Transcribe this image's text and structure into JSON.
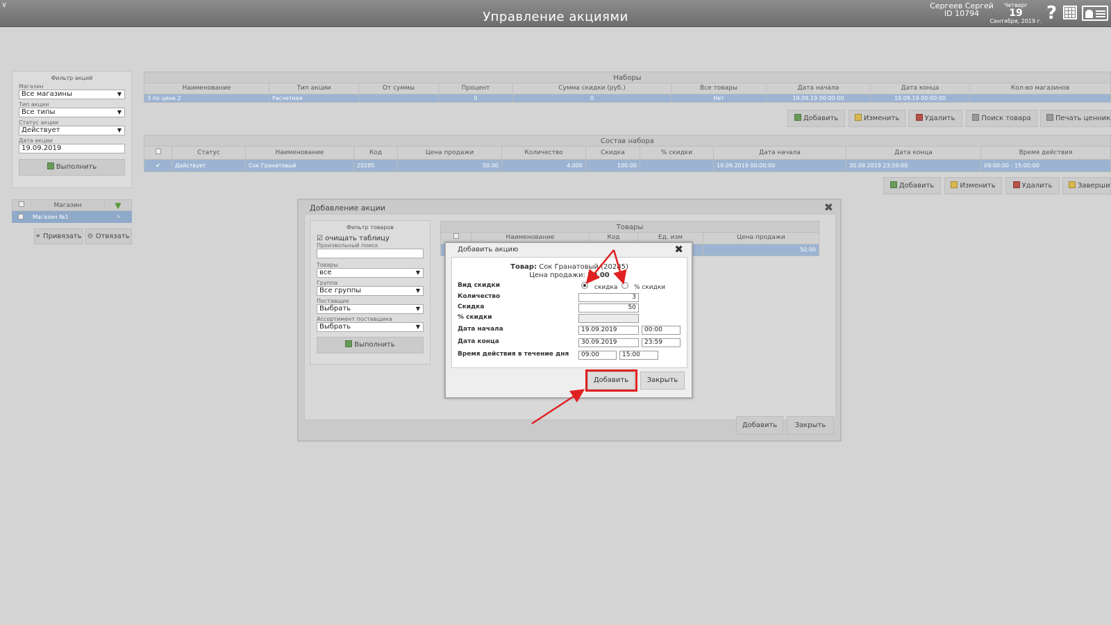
{
  "header": {
    "title": "Управление акциями",
    "user_name": "Сергеев Сергей",
    "user_id": "ID 10794",
    "weekday": "Четверг",
    "day": "19",
    "month_year": "Сентября, 2019 г.",
    "help_icon": "?",
    "icons": [
      "menu-grid-icon",
      "id-card-icon",
      "collapse-chevron-icon"
    ]
  },
  "filter": {
    "title": "Фильтр акций",
    "store_label": "Магазин",
    "store_value": "Все магазины",
    "type_label": "Тип акции",
    "type_value": "Все типы",
    "status_label": "Статус акции",
    "status_value": "Действует",
    "date_label": "Дата акции",
    "date_value": "19.09.2019",
    "run_label": "Выполнить"
  },
  "stores": {
    "header": "Магазин",
    "filter_icon": "funnel-icon",
    "rows": [
      {
        "name": "Магазин №1"
      }
    ],
    "bind_label": "Привязать",
    "unbind_label": "Отвязать"
  },
  "sets": {
    "title": "Наборы",
    "columns": [
      "Наименование",
      "Тип акции",
      "От суммы",
      "Процент",
      "Сумма скидки (руб.)",
      "Все товары",
      "Дата начала",
      "Дата конца",
      "Кол-во магазинов"
    ],
    "rows": [
      [
        "3 по цене 2",
        "Расчетная",
        "",
        "0",
        "0",
        "Нет",
        "19.09.19 00:00:00",
        "19.09.19 00:00:00",
        ""
      ]
    ],
    "buttons": [
      "Добавить",
      "Изменить",
      "Удалить",
      "Поиск товара",
      "Печать ценник"
    ]
  },
  "composition": {
    "title": "Состав набора",
    "columns": [
      "",
      "Статус",
      "Наименование",
      "Код",
      "Цена продажи",
      "Количество",
      "Скидка",
      "% скидки",
      "Дата начала",
      "Дата конца",
      "Время действия"
    ],
    "rows": [
      [
        "✔",
        "Действует",
        "Сок Гранатовый",
        "20285",
        "50.00",
        "4.000",
        "100.00",
        "",
        "19.09.2019 00:00:00",
        "30.09.2019 23:59:00",
        "09:00:00 - 15:00:00"
      ]
    ],
    "buttons": [
      "Добавить",
      "Изменить",
      "Удалить",
      "Заверши"
    ]
  },
  "add_dialog": {
    "title": "Добавление акции",
    "goods_filter": {
      "title": "Фильтр товаров",
      "clear_label": "очищать таблицу",
      "clear_checked": true,
      "search_label": "Произвольный поиск",
      "search_value": "",
      "goods_label": "Товары",
      "goods_value": "все",
      "group_label": "Группа",
      "group_value": "Все группы",
      "supplier_label": "Поставщик",
      "supplier_value": "Выбрать",
      "assortment_label": "Ассортимент поставщика",
      "assortment_value": "Выбрать",
      "run_label": "Выполнить"
    },
    "goods": {
      "title": "Товары",
      "columns": [
        "",
        "Наименование",
        "Код",
        "Ед. изм",
        "Цена продажи"
      ],
      "rows": [
        [
          "",
          "",
          "",
          "",
          "50.00"
        ]
      ]
    },
    "add_label": "Добавить",
    "close_label": "Закрыть"
  },
  "modal": {
    "title": "Добавить акцию",
    "product_label": "Товар:",
    "product_value": "Сок Гранатовый (20285)",
    "price_label": "Цена продажи:",
    "price_value": "50.00",
    "discount_type_label": "Вид скидки",
    "option_amount": "скидка",
    "option_percent": "% скидки",
    "selected_option": "скидка",
    "quantity_label": "Количество",
    "quantity_value": "3",
    "discount_label": "Скидка",
    "discount_value": "50",
    "percent_label": "% скидки",
    "percent_value": "",
    "start_label": "Дата начала",
    "start_date": "19.09.2019",
    "start_time": "00:00",
    "end_label": "Дата конца",
    "end_date": "30.09.2019",
    "end_time": "23:59",
    "daytime_label": "Время действия в течение дня",
    "daytime_from": "09:00",
    "daytime_to": "15:00",
    "add_label": "Добавить",
    "close_label": "Закрыть"
  },
  "colors": {
    "highlight": "#e02020",
    "selected_row": "#9cb4d2",
    "header_bar": "#7d7d7d"
  }
}
